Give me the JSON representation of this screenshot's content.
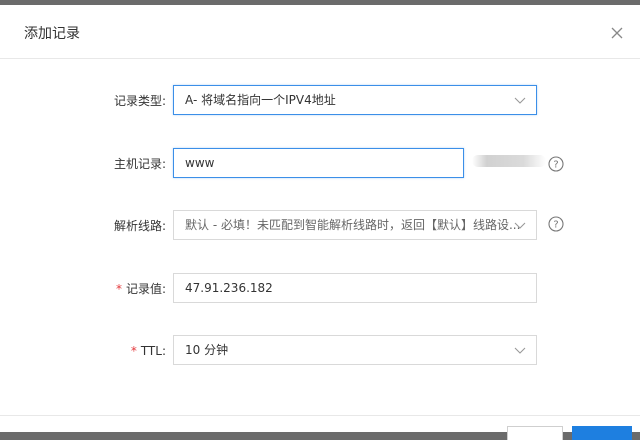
{
  "dialog": {
    "title": "添加记录"
  },
  "form": {
    "record_type": {
      "label": "记录类型:",
      "value": "A- 将域名指向一个IPV4地址"
    },
    "host": {
      "label": "主机记录:",
      "value": "www"
    },
    "line": {
      "label": "解析线路:",
      "value": "默认 - 必填！未匹配到智能解析线路时，返回【默认】线路设..."
    },
    "record_value": {
      "required_mark": "*",
      "label": "记录值:",
      "value": "47.91.236.182"
    },
    "ttl": {
      "required_mark": "*",
      "label": "TTL:",
      "value": "10 分钟"
    }
  },
  "colors": {
    "accent": "#1e7fe0",
    "focus_border": "#3b8fe8",
    "required": "#e4393c"
  }
}
